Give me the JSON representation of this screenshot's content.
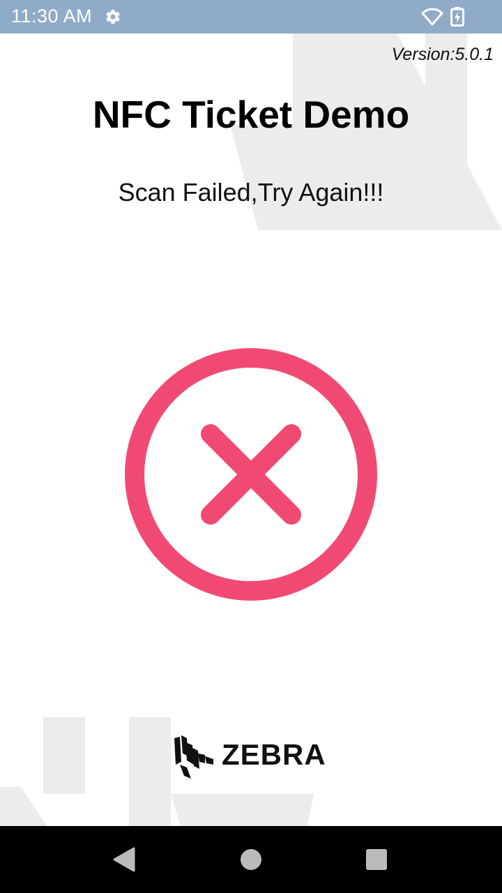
{
  "status_bar": {
    "time": "11:30 AM",
    "icons": [
      "gear-icon",
      "wifi-icon",
      "battery-charging-icon"
    ],
    "color": "#90abc7"
  },
  "app": {
    "version": "Version:5.0.1",
    "title": "NFC Ticket Demo",
    "message": "Scan Failed,Try Again!!!",
    "status_icon": "close-circle-icon",
    "accent_color": "#f14a72",
    "logo_text": "ZEBRA"
  },
  "nav_bar": {
    "buttons": [
      "back",
      "home",
      "recents"
    ]
  }
}
